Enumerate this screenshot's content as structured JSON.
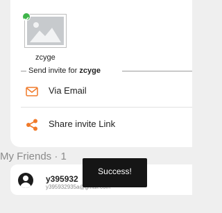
{
  "profile": {
    "username": "zcyge"
  },
  "invite": {
    "prefix": "Send invite for ",
    "name": "zcyge"
  },
  "options": {
    "email_label": "Via Email",
    "share_label": "Share invite Link"
  },
  "friends": {
    "title": "My Friends · 1",
    "items": [
      {
        "name": "y395932",
        "email": "y395932935a@gmail.com"
      }
    ]
  },
  "toast": {
    "message": "Success!"
  },
  "colors": {
    "accent": "#f07a2a",
    "check": "#3fb54a"
  },
  "icons": {
    "email": "envelope-icon",
    "share": "share-icon",
    "avatar": "user-avatar-icon",
    "placeholder": "image-placeholder-icon"
  }
}
